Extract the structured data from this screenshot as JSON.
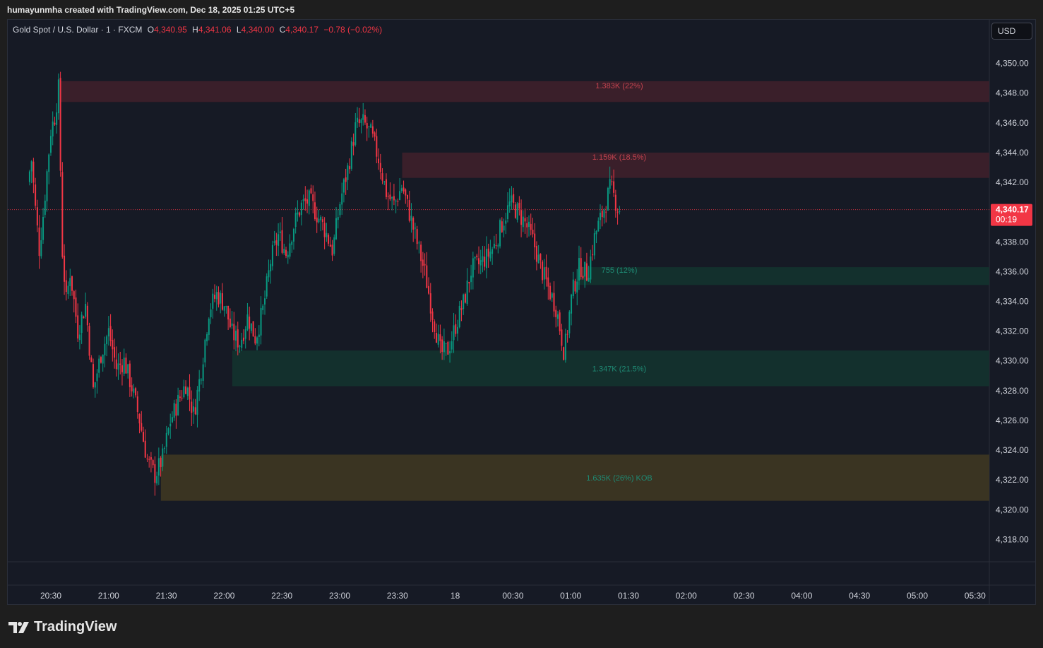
{
  "header": {
    "caption": "humayunmha created with TradingView.com, Dec 18, 2025 01:25 UTC+5"
  },
  "legend": {
    "symbol": "Gold Spot / U.S. Dollar · 1 · FXCM",
    "o_label": "O",
    "o_value": "4,340.95",
    "h_label": "H",
    "h_value": "4,341.06",
    "l_label": "L",
    "l_value": "4,340.00",
    "c_label": "C",
    "c_value": "4,340.17",
    "change": "−0.78 (−0.02%)"
  },
  "currency_button": "USD",
  "current_price": {
    "label": "4,340.17",
    "countdown": "00:19",
    "value": 4340.17
  },
  "brand": {
    "name": "TradingView"
  },
  "colors": {
    "background": "#161a25",
    "up": "#089981",
    "down": "#f23645",
    "supply_zone": "#3a1f2a",
    "demand_zone": "#13302d",
    "kob_zone": "#3a3422",
    "price_line": "#f23645"
  },
  "chart_data": {
    "type": "candlestick",
    "y_axis": {
      "ylim": [
        4316.5,
        4351.5
      ],
      "ticks": [
        4350,
        4348,
        4346,
        4344,
        4342,
        4340,
        4338,
        4336,
        4334,
        4332,
        4330,
        4328,
        4326,
        4324,
        4322,
        4320,
        4318
      ],
      "tick_labels": [
        "4,350.00",
        "4,348.00",
        "4,346.00",
        "4,344.00",
        "4,342.00",
        "4,340.00",
        "4,338.00",
        "4,336.00",
        "4,334.00",
        "4,332.00",
        "4,330.00",
        "4,328.00",
        "4,326.00",
        "4,324.00",
        "4,322.00",
        "4,320.00",
        "4,318.00"
      ]
    },
    "x_axis": {
      "tick_labels": [
        "20:30",
        "21:00",
        "21:30",
        "22:00",
        "22:30",
        "23:00",
        "23:30",
        "18",
        "00:30",
        "01:00",
        "01:30",
        "02:00",
        "02:30",
        "04:00",
        "04:30",
        "05:00",
        "05:30"
      ]
    },
    "zones": [
      {
        "kind": "supply",
        "label": "1.383K (22%)",
        "price_top": 4348.8,
        "price_bottom": 4347.4,
        "start": "20:35"
      },
      {
        "kind": "supply",
        "label": "1.159K (18.5%)",
        "price_top": 4344.0,
        "price_bottom": 4342.3,
        "start": "23:32"
      },
      {
        "kind": "demand",
        "label": "755 (12%)",
        "price_top": 4336.3,
        "price_bottom": 4335.1,
        "start": "01:03"
      },
      {
        "kind": "demand",
        "label": "1.347K (21.5%)",
        "price_top": 4330.7,
        "price_bottom": 4328.3,
        "start": "22:04"
      },
      {
        "kind": "kob",
        "label": "1.635K (26%) KOB",
        "price_top": 4323.7,
        "price_bottom": 4320.6,
        "start": "21:27"
      }
    ],
    "price_path": [
      [
        "20:19",
        4342.0
      ],
      [
        "20:21",
        4343.5
      ],
      [
        "20:23",
        4340.2
      ],
      [
        "20:25",
        4337.5
      ],
      [
        "20:27",
        4339.8
      ],
      [
        "20:29",
        4342.7
      ],
      [
        "20:31",
        4345.5
      ],
      [
        "20:33",
        4346.4
      ],
      [
        "20:35",
        4348.3
      ],
      [
        "20:37",
        4337.2
      ],
      [
        "20:39",
        4334.0
      ],
      [
        "20:41",
        4336.0
      ],
      [
        "20:45",
        4332.0
      ],
      [
        "20:49",
        4333.8
      ],
      [
        "20:53",
        4328.0
      ],
      [
        "20:57",
        4330.5
      ],
      [
        "21:01",
        4332.0
      ],
      [
        "21:05",
        4329.5
      ],
      [
        "21:09",
        4330.0
      ],
      [
        "21:13",
        4328.2
      ],
      [
        "21:17",
        4326.0
      ],
      [
        "21:21",
        4323.3
      ],
      [
        "21:25",
        4322.3
      ],
      [
        "21:29",
        4323.5
      ],
      [
        "21:33",
        4326.0
      ],
      [
        "21:37",
        4327.3
      ],
      [
        "21:41",
        4328.5
      ],
      [
        "21:45",
        4326.4
      ],
      [
        "21:49",
        4329.5
      ],
      [
        "21:53",
        4333.5
      ],
      [
        "21:57",
        4334.5
      ],
      [
        "22:01",
        4333.8
      ],
      [
        "22:05",
        4331.8
      ],
      [
        "22:09",
        4331.2
      ],
      [
        "22:13",
        4333.0
      ],
      [
        "22:17",
        4331.5
      ],
      [
        "22:21",
        4333.5
      ],
      [
        "22:25",
        4336.8
      ],
      [
        "22:29",
        4338.5
      ],
      [
        "22:33",
        4337.2
      ],
      [
        "22:37",
        4339.2
      ],
      [
        "22:41",
        4340.5
      ],
      [
        "22:45",
        4340.8
      ],
      [
        "22:49",
        4339.8
      ],
      [
        "22:53",
        4338.8
      ],
      [
        "22:57",
        4337.4
      ],
      [
        "23:01",
        4340.8
      ],
      [
        "23:05",
        4343.0
      ],
      [
        "23:09",
        4345.8
      ],
      [
        "23:13",
        4346.0
      ],
      [
        "23:17",
        4345.2
      ],
      [
        "23:21",
        4343.5
      ],
      [
        "23:25",
        4341.2
      ],
      [
        "23:29",
        4340.5
      ],
      [
        "23:33",
        4341.8
      ],
      [
        "23:37",
        4339.8
      ],
      [
        "23:41",
        4337.8
      ],
      [
        "23:45",
        4335.8
      ],
      [
        "23:49",
        4333.0
      ],
      [
        "23:53",
        4330.5
      ],
      [
        "23:57",
        4330.8
      ],
      [
        "00:01",
        4332.5
      ],
      [
        "00:05",
        4334.0
      ],
      [
        "00:09",
        4336.2
      ],
      [
        "00:13",
        4336.5
      ],
      [
        "00:17",
        4337.0
      ],
      [
        "00:21",
        4337.8
      ],
      [
        "00:25",
        4339.3
      ],
      [
        "00:29",
        4340.6
      ],
      [
        "00:33",
        4340.0
      ],
      [
        "00:37",
        4339.2
      ],
      [
        "00:41",
        4338.0
      ],
      [
        "00:45",
        4336.2
      ],
      [
        "00:49",
        4334.8
      ],
      [
        "00:53",
        4333.5
      ],
      [
        "00:57",
        4330.5
      ],
      [
        "01:01",
        4334.5
      ],
      [
        "01:05",
        4336.4
      ],
      [
        "01:09",
        4335.8
      ],
      [
        "01:13",
        4338.5
      ],
      [
        "01:17",
        4340.0
      ],
      [
        "01:21",
        4341.7
      ],
      [
        "01:25",
        4340.17
      ]
    ]
  }
}
